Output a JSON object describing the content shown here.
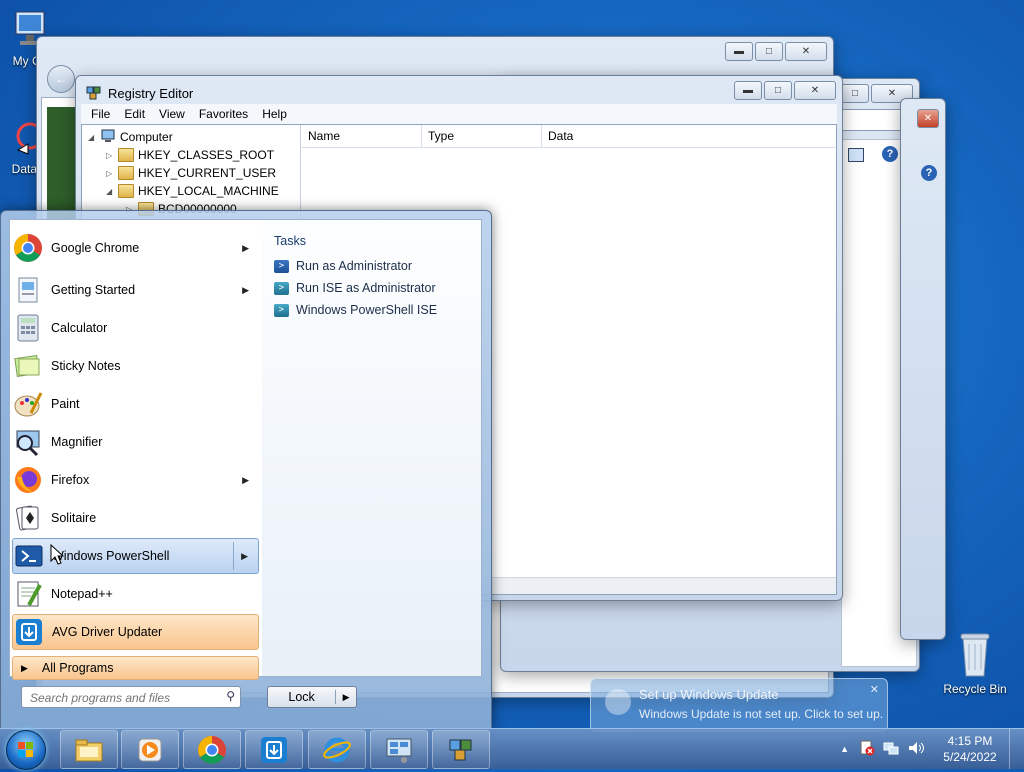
{
  "desktop": {
    "icons": [
      {
        "label": "My Co"
      },
      {
        "label": "DataW"
      },
      {
        "label": "Recycle Bin"
      }
    ]
  },
  "registry_editor": {
    "title": "Registry Editor",
    "menu": [
      "File",
      "Edit",
      "View",
      "Favorites",
      "Help"
    ],
    "tree": [
      "Computer",
      "HKEY_CLASSES_ROOT",
      "HKEY_CURRENT_USER",
      "HKEY_LOCAL_MACHINE",
      "BCD00000000"
    ],
    "columns": [
      "Name",
      "Type",
      "Data"
    ]
  },
  "start_menu": {
    "programs": [
      {
        "label": "Google Chrome",
        "has_submenu": true
      },
      {
        "label": "Getting Started",
        "has_submenu": true
      },
      {
        "label": "Calculator",
        "has_submenu": false
      },
      {
        "label": "Sticky Notes",
        "has_submenu": false
      },
      {
        "label": "Paint",
        "has_submenu": false
      },
      {
        "label": "Magnifier",
        "has_submenu": false
      },
      {
        "label": "Firefox",
        "has_submenu": true
      },
      {
        "label": "Solitaire",
        "has_submenu": false
      },
      {
        "label": "Windows PowerShell",
        "has_submenu": true,
        "state": "hover"
      },
      {
        "label": "Notepad++",
        "has_submenu": false
      },
      {
        "label": "AVG Driver Updater",
        "has_submenu": false,
        "state": "highlighted"
      }
    ],
    "all_programs": "All Programs",
    "tasks_heading": "Tasks",
    "tasks": [
      "Run as Administrator",
      "Run ISE as Administrator",
      "Windows PowerShell ISE"
    ],
    "search_placeholder": "Search programs and files",
    "lock_label": "Lock"
  },
  "balloon": {
    "title": "Set up Windows Update",
    "text": "Windows Update is not set up. Click to set up."
  },
  "taskbar": {
    "time": "4:15 PM",
    "date": "5/24/2022"
  },
  "colors": {
    "hover": "#b9d2f1",
    "highlight": "#f9c58e",
    "taskbar": "#3c5f96"
  }
}
